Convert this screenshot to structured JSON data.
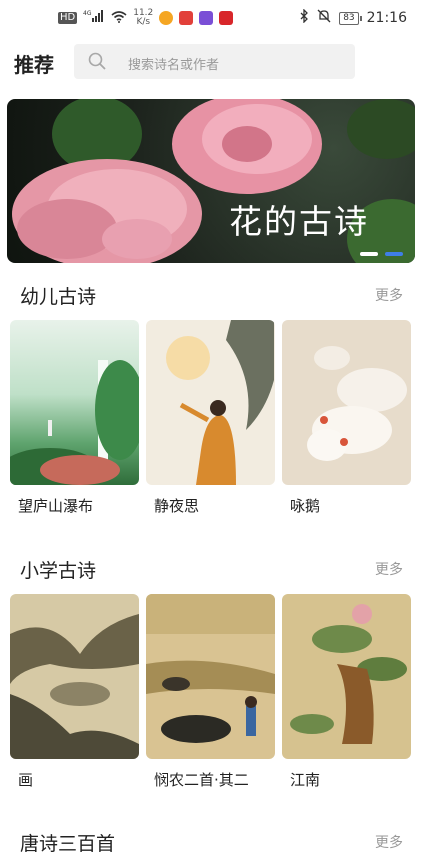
{
  "status_bar": {
    "network_speed": "11.2",
    "network_unit": "K/s",
    "signal": "4G",
    "hd": "HD",
    "battery": "83",
    "time": "21:16"
  },
  "header": {
    "title": "推荐",
    "search_placeholder": "搜索诗名或作者"
  },
  "banner": {
    "title": "花的古诗",
    "active_index": 1,
    "pages": 2
  },
  "sections": [
    {
      "title": "幼儿古诗",
      "more": "更多",
      "cards": [
        {
          "label": "望庐山瀑布"
        },
        {
          "label": "静夜思"
        },
        {
          "label": "咏鹅"
        }
      ]
    },
    {
      "title": "小学古诗",
      "more": "更多",
      "cards": [
        {
          "label": "画"
        },
        {
          "label": "悯农二首·其二"
        },
        {
          "label": "江南"
        }
      ]
    },
    {
      "title": "唐诗三百首",
      "more": "更多"
    }
  ],
  "colors": {
    "indicator_active": "#3f7ee8",
    "indicator_inactive": "#ffffff"
  }
}
